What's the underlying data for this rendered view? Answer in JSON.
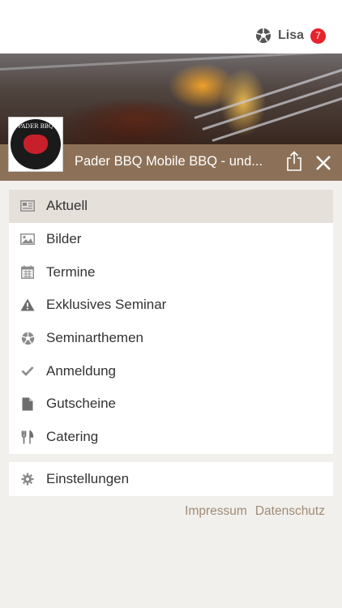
{
  "header": {
    "user_name": "Lisa",
    "badge_count": "7",
    "brand_icon": "soccer-ball-icon"
  },
  "app": {
    "title": "Pader BBQ Mobile BBQ - und...",
    "logo_top_text": "PADER BBQ",
    "accent_color": "#8c7158"
  },
  "menu": {
    "items": [
      {
        "label": "Aktuell",
        "icon": "newspaper-icon",
        "active": true
      },
      {
        "label": "Bilder",
        "icon": "image-icon",
        "active": false
      },
      {
        "label": "Termine",
        "icon": "calendar-icon",
        "active": false
      },
      {
        "label": "Exklusives Seminar",
        "icon": "warning-icon",
        "active": false
      },
      {
        "label": "Seminarthemen",
        "icon": "soccer-ball-icon",
        "active": false
      },
      {
        "label": "Anmeldung",
        "icon": "checkmark-icon",
        "active": false
      },
      {
        "label": "Gutscheine",
        "icon": "document-icon",
        "active": false
      },
      {
        "label": "Catering",
        "icon": "cutlery-icon",
        "active": false
      }
    ],
    "settings_label": "Einstellungen"
  },
  "footer": {
    "impressum": "Impressum",
    "datenschutz": "Datenschutz"
  }
}
